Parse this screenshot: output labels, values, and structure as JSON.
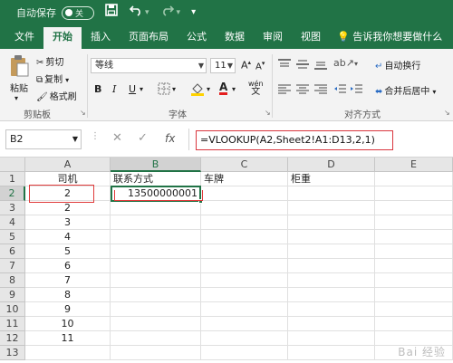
{
  "titlebar": {
    "autosave_label": "自动保存",
    "autosave_state": "关",
    "icons": [
      "save-icon",
      "undo-icon",
      "redo-icon",
      "customize-icon"
    ]
  },
  "tabs": [
    {
      "label": "文件",
      "active": false
    },
    {
      "label": "开始",
      "active": true
    },
    {
      "label": "插入",
      "active": false
    },
    {
      "label": "页面布局",
      "active": false
    },
    {
      "label": "公式",
      "active": false
    },
    {
      "label": "数据",
      "active": false
    },
    {
      "label": "审阅",
      "active": false
    },
    {
      "label": "视图",
      "active": false
    }
  ],
  "tell_me": "告诉我你想要做什么",
  "ribbon": {
    "clipboard": {
      "label": "剪贴板",
      "paste": "粘贴",
      "cut": "剪切",
      "copy": "复制",
      "format_painter": "格式刷"
    },
    "font": {
      "label": "字体",
      "font_name": "等线",
      "font_size": "11",
      "bold": "B",
      "italic": "I",
      "underline": "U",
      "font_color": "A",
      "wen": "wén"
    },
    "alignment": {
      "label": "对齐方式",
      "wrap_text": "自动换行",
      "merge_center": "合并后居中"
    }
  },
  "formula_bar": {
    "name_box": "B2",
    "fx": "fx",
    "formula": "=VLOOKUP(A2,Sheet2!A1:D13,2,1)"
  },
  "grid": {
    "columns": [
      "A",
      "B",
      "C",
      "D",
      "E"
    ],
    "selected_column": "B",
    "selected_row": "2",
    "row_numbers": [
      "1",
      "2",
      "3",
      "4",
      "5",
      "6",
      "7",
      "8",
      "9",
      "10",
      "11",
      "12",
      "13"
    ],
    "header_row": {
      "A": "司机",
      "B": "联系方式",
      "C": "车牌",
      "D": "柜重"
    },
    "col_A_values": [
      "2",
      "2",
      "3",
      "4",
      "5",
      "6",
      "7",
      "8",
      "9",
      "10",
      "11"
    ],
    "B2": "13500000001"
  },
  "watermark": "Bai 经验"
}
